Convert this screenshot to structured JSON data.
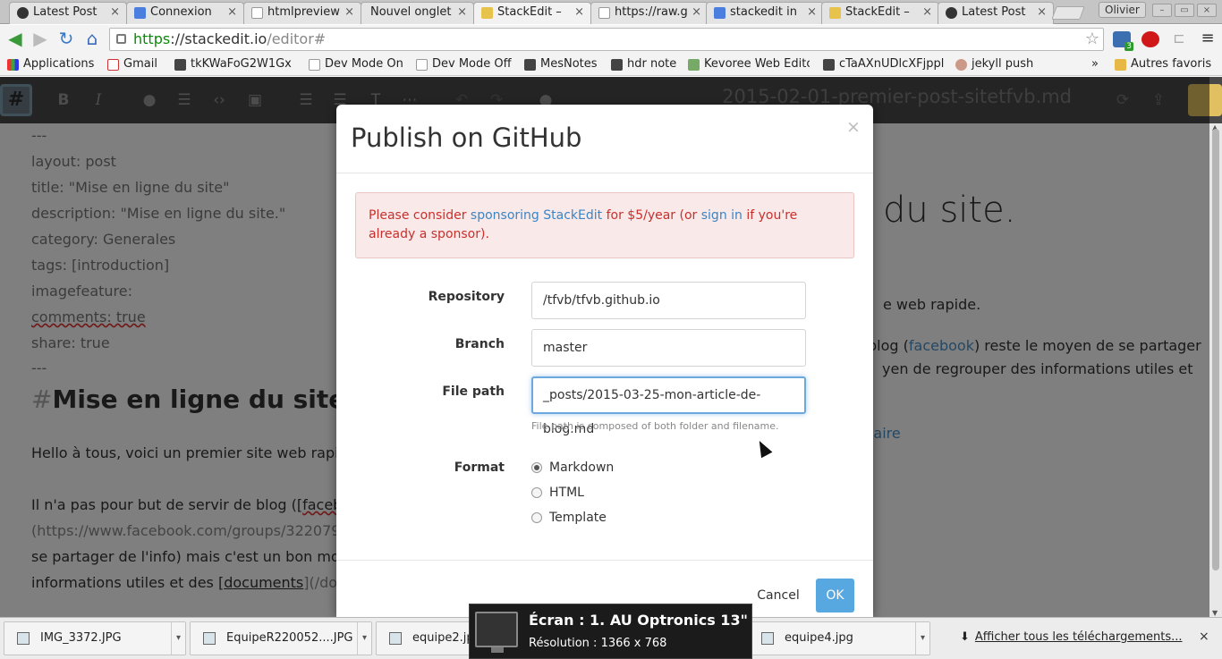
{
  "browser": {
    "tabs": [
      {
        "title": "Latest Post"
      },
      {
        "title": "Connexion"
      },
      {
        "title": "htmlpreview"
      },
      {
        "title": "Nouvel onglet"
      },
      {
        "title": "StackEdit –"
      },
      {
        "title": "https://raw.g"
      },
      {
        "title": "stackedit in"
      },
      {
        "title": "StackEdit –"
      },
      {
        "title": "Latest Post"
      }
    ],
    "profile": "Olivier",
    "url_scheme": "https",
    "url_host": "://stackedit.io",
    "url_path": "/editor#",
    "ext_badge": "3"
  },
  "bookmarks": [
    {
      "label": "Applications"
    },
    {
      "label": "Gmail"
    },
    {
      "label": "tkKWaFoG2W1Gx"
    },
    {
      "label": "Dev Mode On"
    },
    {
      "label": "Dev Mode Off"
    },
    {
      "label": "MesNotes"
    },
    {
      "label": "hdr note"
    },
    {
      "label": "Kevoree Web Edito"
    },
    {
      "label": "cTaAXnUDlcXFjppl"
    },
    {
      "label": "jekyll push"
    }
  ],
  "bookmarks_more": "»",
  "bookmarks_other": "Autres favoris",
  "editor": {
    "logo": "#",
    "doc_title": "2015-02-01-premier-post-sitetfvb.md",
    "frontmatter": [
      "---",
      "layout: post",
      "title: \"Mise en ligne du site\"",
      "description: \"Mise en ligne du site.\"",
      "category: Generales",
      "tags: [introduction]",
      "imagefeature:",
      "comments: true",
      "share: true",
      "---"
    ],
    "heading_hash": "#",
    "heading": "Mise en ligne du site.",
    "para1": "Hello à tous, voici un premier site web rapid",
    "para2_start": "Il n'a pas pour but de servir de blog ([",
    "para2_link": "facebo",
    "para3": "(https://www.facebook.com/groups/3220796",
    "para4": "se partager de l'info) mais c'est un bon moye",
    "para5_start": "informations utiles et des [",
    "para5_link": "documents",
    "para5_end": "](/docu"
  },
  "preview": {
    "title": "du site.",
    "line1": "e web rapide.",
    "line2_start": "blog (",
    "line2_link": "facebook",
    "line2_end": ") reste le moyen de se partager",
    "line3": "yen de regrouper des informations utiles et",
    "line4_link": "ntaire"
  },
  "modal": {
    "title": "Publish on GitHub",
    "close": "×",
    "alert_pre": "Please consider ",
    "alert_link1": "sponsoring StackEdit",
    "alert_mid": " for $5/year (or ",
    "alert_link2": "sign in",
    "alert_post": " if you're already a sponsor).",
    "repo_label": "Repository",
    "repo_value": "/tfvb/tfvb.github.io",
    "branch_label": "Branch",
    "branch_value": "master",
    "path_label": "File path",
    "path_value": "_posts/2015-03-25-mon-article-de-blog.md",
    "path_help": "File path is composed of both folder and filename.",
    "format_label": "Format",
    "formats": [
      {
        "label": "Markdown",
        "selected": true
      },
      {
        "label": "HTML",
        "selected": false
      },
      {
        "label": "Template",
        "selected": false
      }
    ],
    "cancel": "Cancel",
    "ok": "OK"
  },
  "downloads": {
    "items": [
      {
        "name": "IMG_3372.JPG"
      },
      {
        "name": "EquipeR220052....JPG"
      },
      {
        "name": "equipe2.jpg"
      },
      {
        "name": "equipe4.jpg"
      }
    ],
    "show_all": "Afficher tous les téléchargements...",
    "close": "×"
  },
  "osd": {
    "line1": "Écran : 1. AU Optronics 13\"",
    "line2": "Résolution : 1366 x 768"
  },
  "colors": {
    "accent": "#57a7e1",
    "alert_text": "#c9302c",
    "alert_bg": "#f9e9e9",
    "url_secure": "#0a8a0a"
  }
}
